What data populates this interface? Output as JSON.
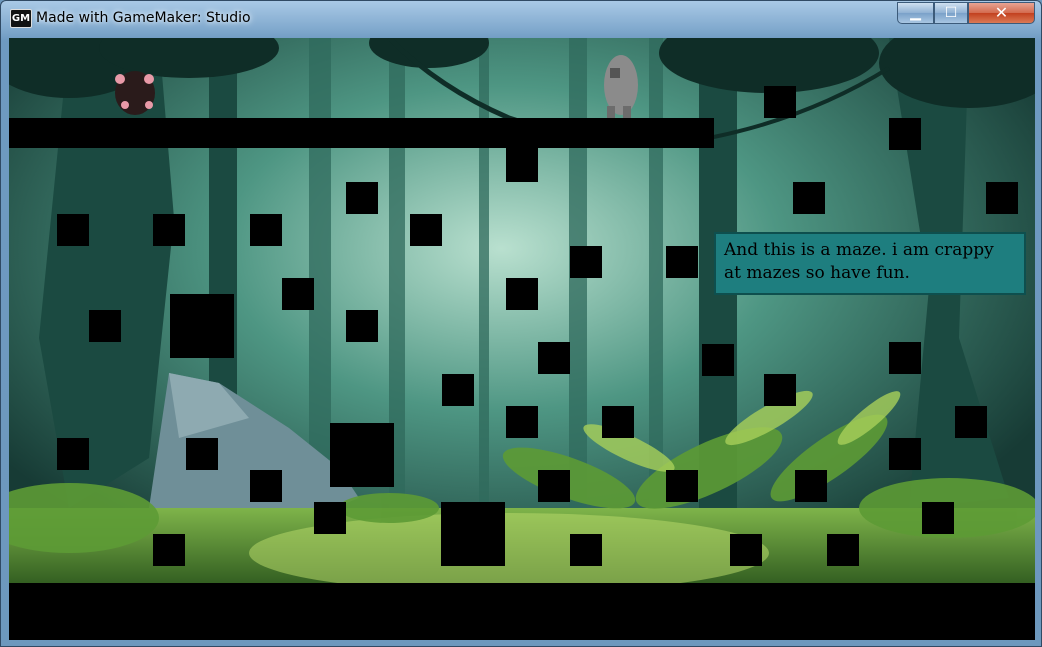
{
  "window": {
    "title": "Made with GameMaker: Studio",
    "app_icon": "gamemaker-icon",
    "controls": [
      {
        "name": "minimize-button",
        "glyph": "▁"
      },
      {
        "name": "maximize-button",
        "glyph": "☐"
      },
      {
        "name": "close-button",
        "glyph": "✕"
      }
    ]
  },
  "game": {
    "dialog_text": "And this is a maze. i am crappy at mazes so have fun.",
    "colors": {
      "block": "#000000",
      "dialog_bg": "#1e7e7f",
      "scene_dark": "#1d4a42",
      "scene_light": "#a9d6b8",
      "foliage": "#6ea83c"
    },
    "sprites": [
      "gray-creature-player",
      "pink-eyed-bat-enemy"
    ]
  }
}
